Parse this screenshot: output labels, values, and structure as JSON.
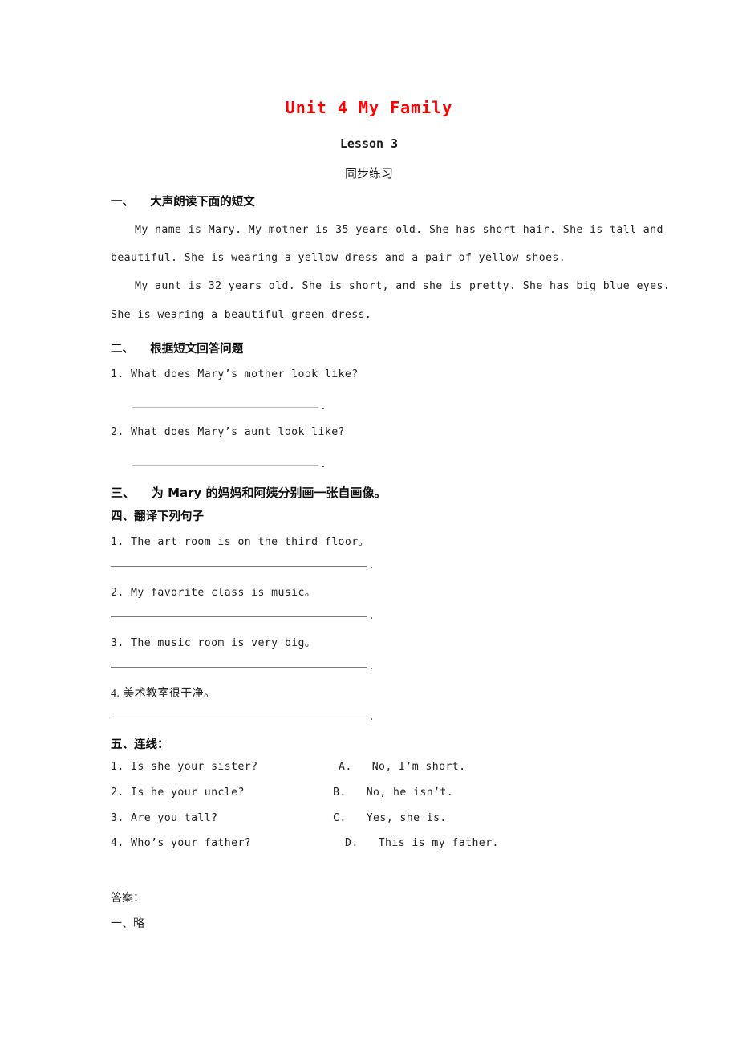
{
  "document": {
    "title": "Unit 4 My Family",
    "title_color": "#ff0000",
    "lesson": "Lesson 3",
    "worksheet_label": "同步练习"
  },
  "sections": {
    "one": {
      "heading": "一、    大声朗读下面的短文",
      "paragraphs": [
        "My name is Mary. My mother is 35 years old. She has short hair. She is tall and",
        "beautiful. She is wearing a yellow dress and a pair of yellow shoes.",
        "My aunt is 32 years old. She is short, and she is pretty. She has big blue eyes.",
        "She is wearing a beautiful green dress."
      ]
    },
    "two": {
      "heading": "二、    根据短文回答问题",
      "questions": [
        "1. What does Mary’s mother look like?",
        "2. What does Mary’s aunt look like?"
      ],
      "blank_dot": "."
    },
    "three": {
      "heading": "三、    为 Mary 的妈妈和阿姨分别画一张自画像。"
    },
    "four": {
      "heading": "四、翻译下列句子",
      "sentences": [
        "1. The art room is on the third floor。",
        "2. My favorite class is music。",
        "3. The music room is very big。",
        "4. 美术教室很干净。"
      ],
      "blank_dot": "."
    },
    "five": {
      "heading": "五、连线：",
      "left_column": [
        "1. Is she your sister?",
        "2. Is he your uncle?",
        "3. Are you tall?",
        "4. Who’s your father?"
      ],
      "right_column": [
        "A.   No, I’m short.",
        "B.   No, he isn’t.",
        "C.   Yes, she is.",
        "D.   This is my father."
      ]
    }
  },
  "answers": {
    "label": "答案：",
    "items": [
      "一、略"
    ]
  }
}
